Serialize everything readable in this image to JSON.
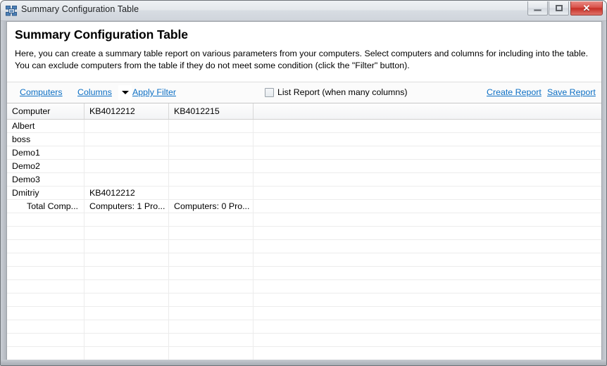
{
  "window": {
    "title": "Summary Configuration Table",
    "icon": "table-grid-icon",
    "controls": {
      "minimize_label": "–",
      "restore_label": "□",
      "close_label": "✕"
    }
  },
  "header": {
    "title": "Summary Configuration Table",
    "description": "Here, you can create a summary table report on various parameters from your computers. Select computers and columns for including into the table. You can exclude computers from the table if they do not meet some condition (click the \"Filter\" button)."
  },
  "toolbar": {
    "computers_label": "Computers",
    "columns_label": "Columns",
    "columns_dropdown_icon": "chevron-down-icon",
    "apply_filter_label": "Apply Filter",
    "list_report_label": "List Report (when many columns)",
    "list_report_checked": false,
    "create_report_label": "Create Report",
    "save_report_label": "Save Report",
    "link_color": "#0c6fc4"
  },
  "grid": {
    "columns": [
      "Computer",
      "KB4012212",
      "KB4012215",
      ""
    ],
    "rows": [
      {
        "cells": [
          "Albert",
          "",
          "",
          ""
        ],
        "is_total": false
      },
      {
        "cells": [
          "boss",
          "",
          "",
          ""
        ],
        "is_total": false
      },
      {
        "cells": [
          "Demo1",
          "",
          "",
          ""
        ],
        "is_total": false
      },
      {
        "cells": [
          "Demo2",
          "",
          "",
          ""
        ],
        "is_total": false
      },
      {
        "cells": [
          "Demo3",
          "",
          "",
          ""
        ],
        "is_total": false
      },
      {
        "cells": [
          "Dmitriy",
          "KB4012212",
          "",
          ""
        ],
        "is_total": false
      },
      {
        "cells": [
          "Total Comp...",
          "Computers: 1 Pro...",
          "Computers: 0 Pro...",
          ""
        ],
        "is_total": true
      }
    ],
    "empty_row_count": 11
  }
}
